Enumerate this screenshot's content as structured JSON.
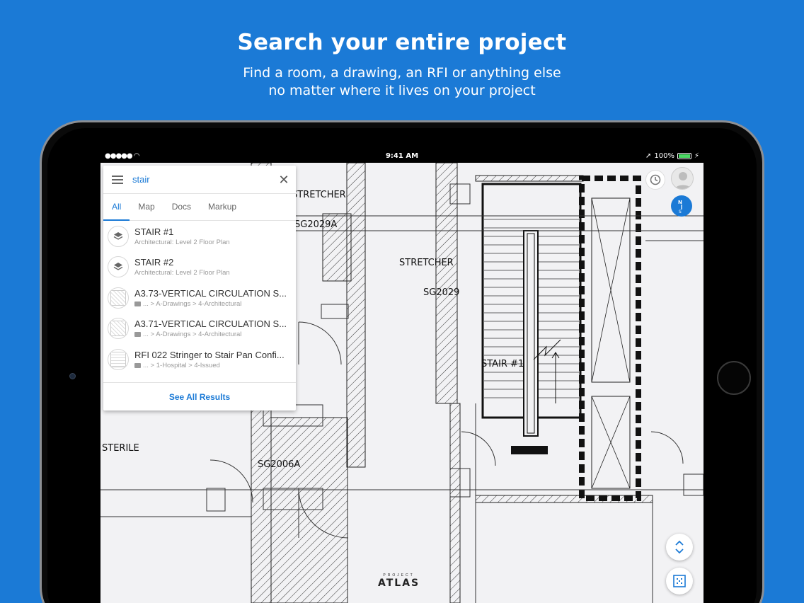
{
  "promo": {
    "headline": "Search your entire project",
    "subline_1": "Find a room, a drawing, an RFI or anything else",
    "subline_2": "no matter where it lives on your project"
  },
  "status_bar": {
    "signal": "●●●●● ",
    "time": "9:41 AM",
    "battery": "100%"
  },
  "plan_labels": {
    "stretcher_1": "STRETCHER",
    "sg2029a": "SG2029A",
    "stretcher_2": "STRETCHER",
    "sg2029": "SG2029",
    "stair_1": "STAIR #1",
    "sterile": "STERILE",
    "sg2006a": "SG2006A"
  },
  "search": {
    "query": "stair",
    "tabs": [
      {
        "label": "All",
        "active": true
      },
      {
        "label": "Map",
        "active": false
      },
      {
        "label": "Docs",
        "active": false
      },
      {
        "label": "Markup",
        "active": false
      }
    ],
    "results": [
      {
        "title": "STAIR #1",
        "subtitle": "Architectural: Level 2 Floor Plan",
        "icon": "layers-icon"
      },
      {
        "title": "STAIR #2",
        "subtitle": "Architectural: Level 2 Floor Plan",
        "icon": "layers-icon"
      },
      {
        "title": "A3.73-VERTICAL CIRCULATION S...",
        "subtitle": "... > A-Drawings > 4-Architectural",
        "icon": "drawing-thumbnail"
      },
      {
        "title": "A3.71-VERTICAL CIRCULATION S...",
        "subtitle": "... > A-Drawings > 4-Architectural",
        "icon": "drawing-thumbnail"
      },
      {
        "title": "RFI 022 Stringer to Stair Pan Confi...",
        "subtitle": "... > 1-Hospital > 4-Issued",
        "icon": "document-thumbnail"
      }
    ],
    "see_all": "See All Results"
  },
  "branding": {
    "small": "PROJECT",
    "big": "ATLAS"
  },
  "colors": {
    "background": "#1b7ad6",
    "accent": "#1b7ad6",
    "battery": "#4cd964"
  }
}
